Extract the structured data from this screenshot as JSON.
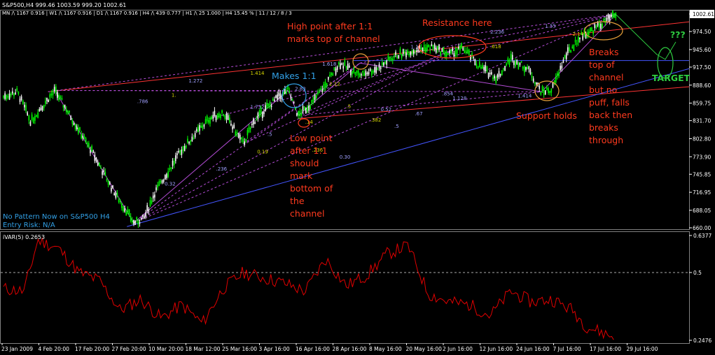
{
  "header": {
    "symbol_line": "S&P500,H4  999.46 1003.59 999.20 1002.61",
    "timeframe_line": "MN /\\ 1167  0.916  |  W1 /\\ 1167  0.916  |  D1 /\\ 1167  0.916  |  H4 /\\ 439  0.777  |  H1 /\\ 25  1.000  |  H4  15.45 %  |  11 / 12 / 8 / 3",
    "pattern_line": "No Pattern Now on S&P500 H4",
    "risk_line": "Entry Risk: N/A"
  },
  "indicator": {
    "label": "iVAR(5) 0.2653"
  },
  "colors": {
    "background": "#000000",
    "bull_candle": "#00ff00",
    "bear_candle": "#ffffff",
    "channel_red": "#ff3333",
    "channel_blue": "#4455ff",
    "fib_violet": "#b44cd6",
    "annotation_red": "#ff3a1e",
    "annotation_blue": "#32a0e6",
    "target_green": "#2ecc40",
    "indicator_red": "#e00000",
    "axis_text": "#ffffff"
  },
  "annotations": {
    "high_point": [
      "High point after 1:1",
      "marks top of channel"
    ],
    "resistance": "Resistance here",
    "makes_11": "Makes 1:1",
    "low_point": [
      "Low point",
      "after 1:1",
      "should",
      "mark",
      "bottom of",
      "the",
      "channel"
    ],
    "support": "Support holds",
    "breaks": [
      "Breaks",
      "top of",
      "channel",
      "but no",
      "puff, falls",
      "back then",
      "breaks",
      "through"
    ],
    "target": "TARGET",
    "question": "???"
  },
  "fib_labels": [
    "1.414",
    "1.272",
    ".786",
    "1.",
    "2.83",
    "1.618",
    "2.12",
    "1.732",
    ".5",
    "0.19",
    ".236",
    "0.32",
    ".5",
    "0.52",
    ".854",
    ".382",
    ".67",
    "0.30",
    ".236",
    "1.128",
    "1.414",
    ".618",
    "2.236",
    "1.55",
    "2.14",
    "1.1",
    ".5",
    ".14"
  ],
  "chart_data": {
    "type": "line",
    "title": "S&P500,H4",
    "price_axis": {
      "ticks": [
        1002.61,
        974.5,
        945.6,
        917.5,
        888.6,
        859.75,
        831.7,
        802.8,
        773.9,
        745.85,
        716.95,
        688.05,
        660.0
      ],
      "range": [
        660.0,
        1002.61
      ],
      "last_price": 1002.61
    },
    "indicator_axis": {
      "ticks": [
        0.6377,
        0.5,
        0.2476
      ],
      "range": [
        0.2476,
        0.6377
      ],
      "reference_level": 0.5
    },
    "x_axis": {
      "tick_labels": [
        "23 Jan 2009",
        "4 Feb 20:00",
        "17 Feb 20:00",
        "27 Feb 20:00",
        "10 Mar 20:00",
        "18 Mar 12:00",
        "25 Mar 16:00",
        "3 Apr 16:00",
        "16 Apr 16:00",
        "28 Apr 16:00",
        "8 May 16:00",
        "20 May 16:00",
        "2 Jun 16:00",
        "12 Jun 16:00",
        "24 Jun 16:00",
        "7 Jul 16:00",
        "17 Jul 16:00",
        "29 Jul 16:00"
      ]
    },
    "series": [
      {
        "name": "S&P500 H4",
        "x": [
          0,
          0.02,
          0.04,
          0.06,
          0.075,
          0.1,
          0.13,
          0.16,
          0.19,
          0.205,
          0.22,
          0.26,
          0.3,
          0.32,
          0.35,
          0.365,
          0.38,
          0.4,
          0.415,
          0.43,
          0.45,
          0.47,
          0.49,
          0.52,
          0.545,
          0.57,
          0.6,
          0.625,
          0.65,
          0.67,
          0.695,
          0.72,
          0.74,
          0.765,
          0.785,
          0.8,
          0.82,
          0.84,
          0.86,
          0.88,
          0.893
        ],
        "y": [
          870,
          878,
          830,
          860,
          880,
          835,
          780,
          720,
          668,
          675,
          715,
          785,
          835,
          845,
          795,
          830,
          848,
          868,
          880,
          840,
          860,
          890,
          924,
          905,
          915,
          935,
          945,
          950,
          938,
          948,
          918,
          900,
          932,
          915,
          878,
          882,
          935,
          965,
          978,
          992,
          1002
        ]
      },
      {
        "name": "iVAR(5)",
        "x": [
          0,
          0.03,
          0.05,
          0.08,
          0.11,
          0.14,
          0.17,
          0.2,
          0.23,
          0.26,
          0.29,
          0.32,
          0.35,
          0.38,
          0.41,
          0.44,
          0.47,
          0.5,
          0.53,
          0.56,
          0.59,
          0.62,
          0.65,
          0.68,
          0.71,
          0.74,
          0.77,
          0.8,
          0.83,
          0.85,
          0.87,
          0.89
        ],
        "y": [
          0.44,
          0.43,
          0.62,
          0.59,
          0.5,
          0.47,
          0.36,
          0.4,
          0.33,
          0.38,
          0.31,
          0.44,
          0.5,
          0.48,
          0.46,
          0.43,
          0.55,
          0.45,
          0.49,
          0.57,
          0.6,
          0.42,
          0.39,
          0.38,
          0.34,
          0.43,
          0.39,
          0.4,
          0.36,
          0.3,
          0.28,
          0.26
        ]
      }
    ],
    "legend": "none",
    "grid": false
  }
}
